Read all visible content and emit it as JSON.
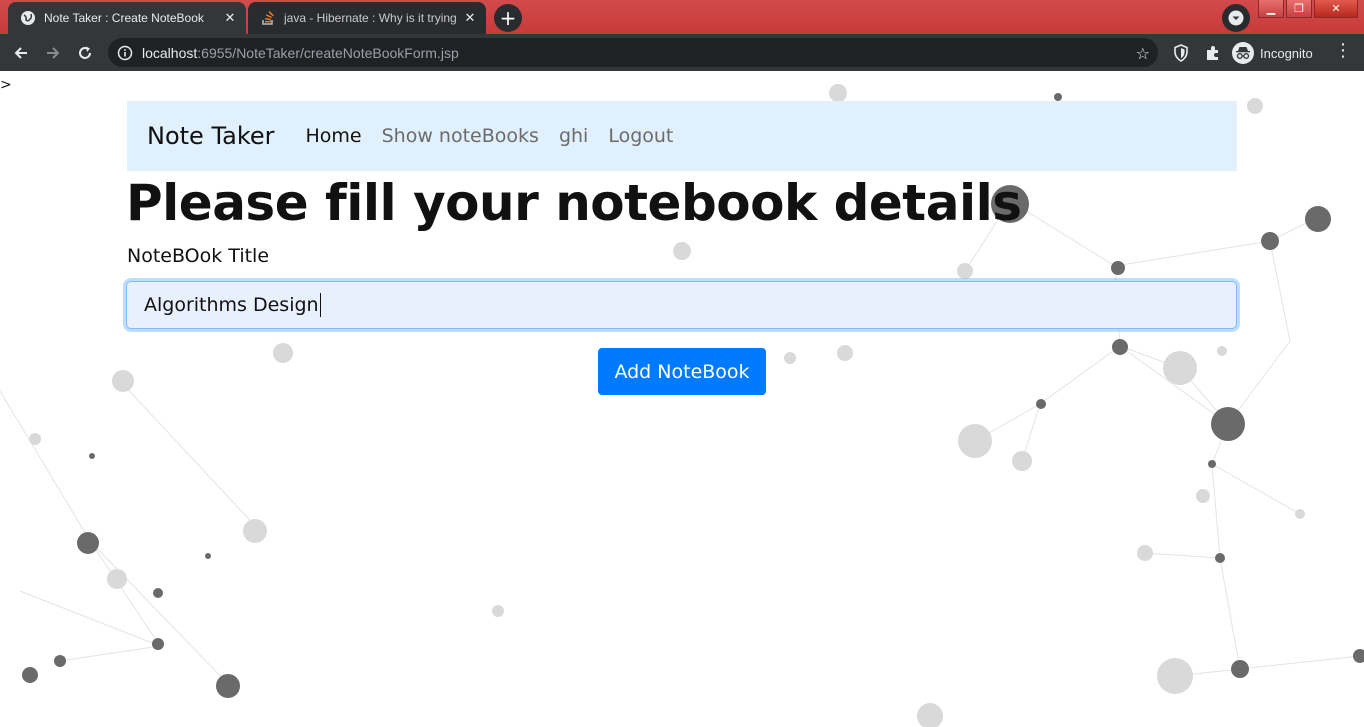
{
  "browser": {
    "tabs": [
      {
        "title": "Note Taker : Create NoteBook",
        "active": true,
        "icon": "globe-icon"
      },
      {
        "title": "java - Hibernate : Why is it trying",
        "active": false,
        "icon": "stackoverflow-icon"
      }
    ],
    "url": {
      "host": "localhost",
      "path": ":6955/NoteTaker/createNoteBookForm.jsp"
    },
    "profile_label": "Incognito"
  },
  "page": {
    "stray_char": ">",
    "navbar": {
      "brand": "Note Taker",
      "links": [
        "Home",
        "Show noteBooks",
        "ghi",
        "Logout"
      ],
      "active_link": "Home"
    },
    "heading": "Please fill your notebook details",
    "form": {
      "title_label": "NoteBOok Title",
      "title_value": "Algorithms Design",
      "submit_label": "Add NoteBook"
    }
  },
  "colors": {
    "tabstrip": "#d24b4b",
    "toolbar": "#35363a",
    "navbar_bg": "#e1f0fd",
    "input_bg": "#e8f0fe",
    "button": "#007bff"
  }
}
